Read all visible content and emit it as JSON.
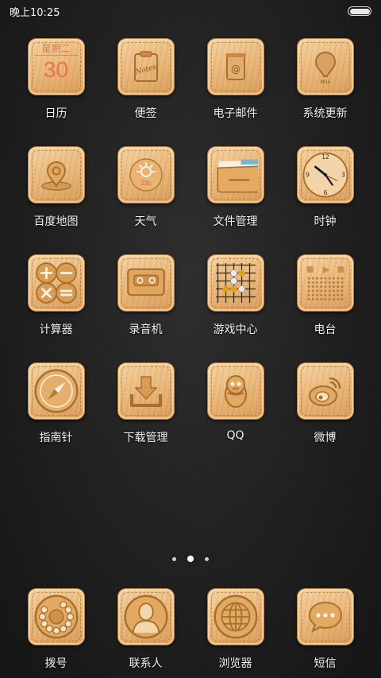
{
  "status_bar": {
    "time": "晚上10:25"
  },
  "calendar": {
    "weekday": "星期二",
    "day": "30"
  },
  "apps": [
    {
      "label": "日历",
      "icon": "calendar-icon"
    },
    {
      "label": "便签",
      "icon": "notes-icon",
      "icon_text": "Notes"
    },
    {
      "label": "电子邮件",
      "icon": "email-icon"
    },
    {
      "label": "系统更新",
      "icon": "system-update-icon",
      "icon_text": "MIUI"
    },
    {
      "label": "百度地图",
      "icon": "map-pin-icon"
    },
    {
      "label": "天气",
      "icon": "weather-sun-icon",
      "icon_text": "23c"
    },
    {
      "label": "文件管理",
      "icon": "folder-icon"
    },
    {
      "label": "时钟",
      "icon": "clock-icon"
    },
    {
      "label": "计算器",
      "icon": "calculator-icon"
    },
    {
      "label": "录音机",
      "icon": "cassette-icon"
    },
    {
      "label": "游戏中心",
      "icon": "go-board-icon"
    },
    {
      "label": "电台",
      "icon": "radio-icon"
    },
    {
      "label": "指南针",
      "icon": "compass-icon"
    },
    {
      "label": "下载管理",
      "icon": "download-icon"
    },
    {
      "label": "QQ",
      "icon": "qq-penguin-icon"
    },
    {
      "label": "微博",
      "icon": "weibo-icon"
    }
  ],
  "clock_numbers": {
    "n12": "12",
    "n3": "3",
    "n6": "6",
    "n9": "9"
  },
  "page_indicator": {
    "count": 3,
    "active_index": 1
  },
  "dock": [
    {
      "label": "拨号",
      "icon": "rotary-dial-icon"
    },
    {
      "label": "联系人",
      "icon": "contact-icon"
    },
    {
      "label": "浏览器",
      "icon": "globe-icon"
    },
    {
      "label": "短信",
      "icon": "message-bubble-icon"
    }
  ],
  "colors": {
    "wood_light": "#f6d3a3",
    "wood_dark": "#d99e5c",
    "calendar_red": "#e8735a",
    "background": "#1f1f1f"
  }
}
